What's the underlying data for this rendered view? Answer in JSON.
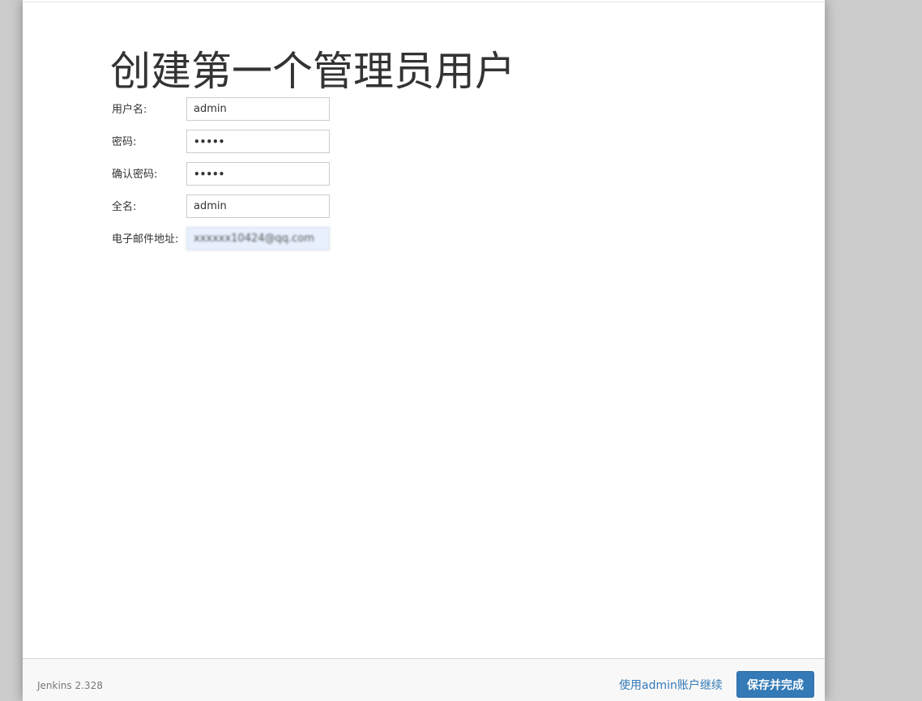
{
  "page": {
    "title": "创建第一个管理员用户"
  },
  "form": {
    "username": {
      "label": "用户名:",
      "value": "admin"
    },
    "password": {
      "label": "密码:",
      "value": "•••••"
    },
    "confirm_password": {
      "label": "确认密码:",
      "value": "•••••"
    },
    "fullname": {
      "label": "全名:",
      "value": "admin"
    },
    "email": {
      "label": "电子邮件地址:",
      "value": "xxxxxx10424@qq.com"
    }
  },
  "footer": {
    "version": "Jenkins 2.328",
    "continue_link": "使用admin账户继续",
    "save_button": "保存并完成"
  },
  "colors": {
    "primary_button": "#337ab7",
    "link": "#337ab7",
    "backdrop": "#cccccc",
    "autofill_bg": "#e8f0fe"
  }
}
